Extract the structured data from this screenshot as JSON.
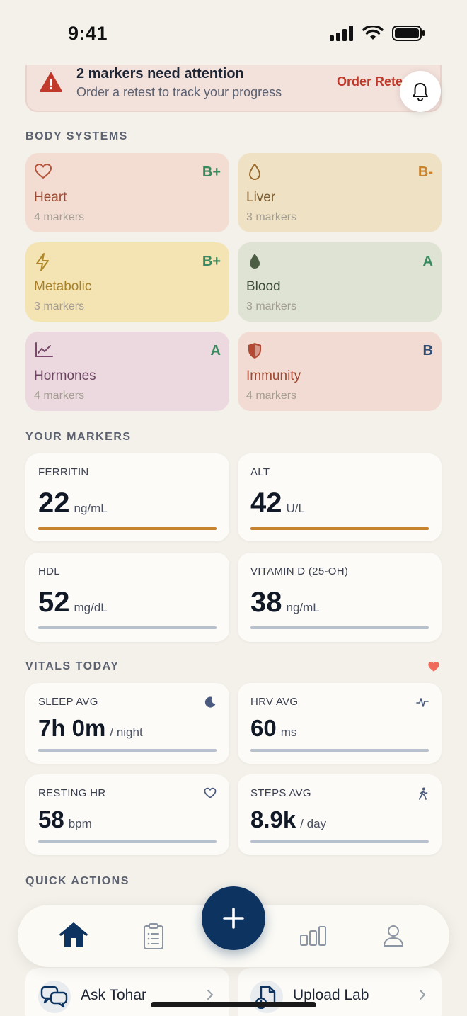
{
  "status": {
    "time": "9:41"
  },
  "alert": {
    "title": "2 markers need attention",
    "subtitle": "Order a retest to track your progress",
    "cta": "Order Rete"
  },
  "sections": {
    "body_systems": "BODY SYSTEMS",
    "your_markers": "YOUR MARKERS",
    "vitals_today": "VITALS TODAY",
    "quick_actions": "QUICK ACTIONS"
  },
  "systems": [
    {
      "name": "Heart",
      "grade": "B+",
      "count": "4 markers",
      "icon": "heart-outline-icon"
    },
    {
      "name": "Liver",
      "grade": "B-",
      "count": "3 markers",
      "icon": "drop-outline-icon"
    },
    {
      "name": "Metabolic",
      "grade": "B+",
      "count": "3 markers",
      "icon": "lightning-icon"
    },
    {
      "name": "Blood",
      "grade": "A",
      "count": "3 markers",
      "icon": "drop-filled-icon"
    },
    {
      "name": "Hormones",
      "grade": "A",
      "count": "4 markers",
      "icon": "trend-chart-icon"
    },
    {
      "name": "Immunity",
      "grade": "B",
      "count": "4 markers",
      "icon": "shield-icon"
    }
  ],
  "markers": [
    {
      "label": "FERRITIN",
      "value": "22",
      "unit": "ng/mL",
      "status_color": "#c8832e"
    },
    {
      "label": "ALT",
      "value": "42",
      "unit": "U/L",
      "status_color": "#c8832e"
    },
    {
      "label": "HDL",
      "value": "52",
      "unit": "mg/dL",
      "status_color": "#b7c0cd"
    },
    {
      "label": "VITAMIN D (25-OH)",
      "value": "38",
      "unit": "ng/mL",
      "status_color": "#b7c0cd"
    }
  ],
  "vitals": [
    {
      "label": "SLEEP AVG",
      "value": "7h 0m",
      "unit": "/ night",
      "icon": "moon-icon"
    },
    {
      "label": "HRV AVG",
      "value": "60",
      "unit": "ms",
      "icon": "pulse-icon"
    },
    {
      "label": "RESTING HR",
      "value": "58",
      "unit": "bpm",
      "icon": "heart-outline-icon"
    },
    {
      "label": "STEPS AVG",
      "value": "8.9k",
      "unit": "/ day",
      "icon": "walking-icon"
    }
  ],
  "quick_actions": [
    {
      "label": "Ask Tohar",
      "icon": "chat-icon"
    },
    {
      "label": "Upload Lab",
      "icon": "upload-document-icon"
    }
  ],
  "tabs": [
    "home-icon",
    "clipboard-icon",
    "bar-chart-icon",
    "profile-icon"
  ],
  "colors": {
    "accent_navy": "#0d3461",
    "warning": "#c8832e",
    "alert_red": "#c0392b",
    "good_green": "#3a8a5f"
  }
}
